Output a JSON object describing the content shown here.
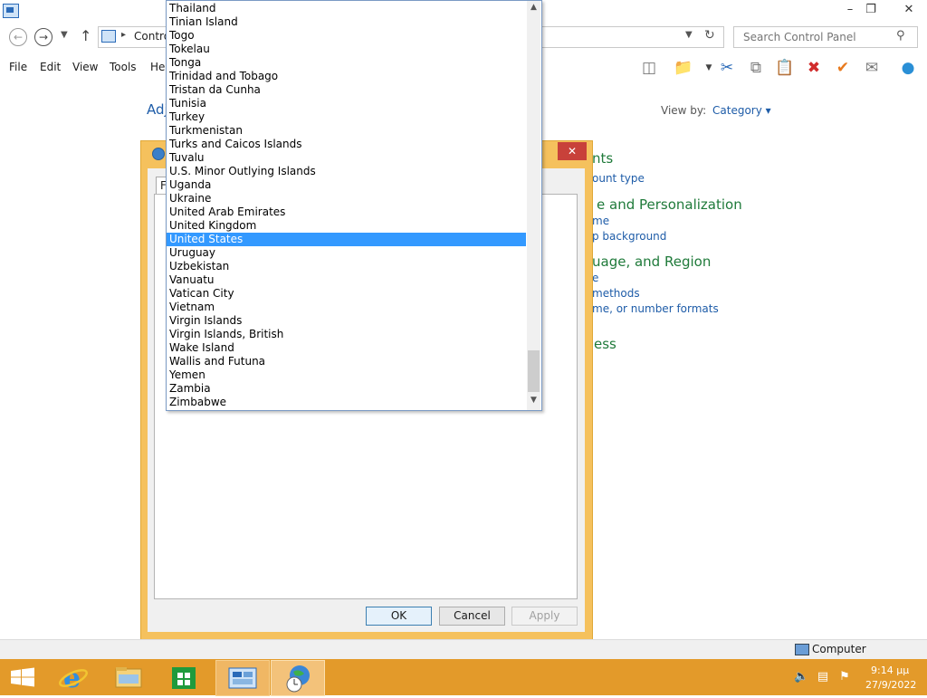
{
  "window": {
    "address_text": "Contro",
    "search_placeholder": "Search Control Panel"
  },
  "menu": [
    "File",
    "Edit",
    "View",
    "Tools",
    "Hel"
  ],
  "content": {
    "title_partial": "Adj",
    "view_by_label": "View by:",
    "view_by_value": "Category ▾",
    "categories": [
      {
        "head": "nts",
        "links": [
          "ount type"
        ]
      },
      {
        "head": "e and Personalization",
        "links": [
          "me",
          "p background"
        ]
      },
      {
        "head": "uage, and Region",
        "links": [
          "e",
          "methods",
          "me, or number formats"
        ]
      },
      {
        "head": "ess",
        "links": []
      }
    ]
  },
  "dialog": {
    "tab_label": "F",
    "buttons": {
      "ok": "OK",
      "cancel": "Cancel",
      "apply": "Apply"
    },
    "close_glyph": "✕"
  },
  "dropdown": {
    "selected": "United States",
    "items": [
      "Thailand",
      "Tinian Island",
      "Togo",
      "Tokelau",
      "Tonga",
      "Trinidad and Tobago",
      "Tristan da Cunha",
      "Tunisia",
      "Turkey",
      "Turkmenistan",
      "Turks and Caicos Islands",
      "Tuvalu",
      "U.S. Minor Outlying Islands",
      "Uganda",
      "Ukraine",
      "United Arab Emirates",
      "United Kingdom",
      "United States",
      "Uruguay",
      "Uzbekistan",
      "Vanuatu",
      "Vatican City",
      "Vietnam",
      "Virgin Islands",
      "Virgin Islands, British",
      "Wake Island",
      "Wallis and Futuna",
      "Yemen",
      "Zambia",
      "Zimbabwe"
    ]
  },
  "statusbar": {
    "computer_label": "Computer"
  },
  "taskbar": {
    "time": "9:14 μμ",
    "date": "27/9/2022"
  },
  "colors": {
    "accent": "#3399ff",
    "taskbar": "#e39a2a",
    "dialog_frame": "#f5c15d",
    "link": "#1e5ca8",
    "category": "#1f7a3a"
  }
}
